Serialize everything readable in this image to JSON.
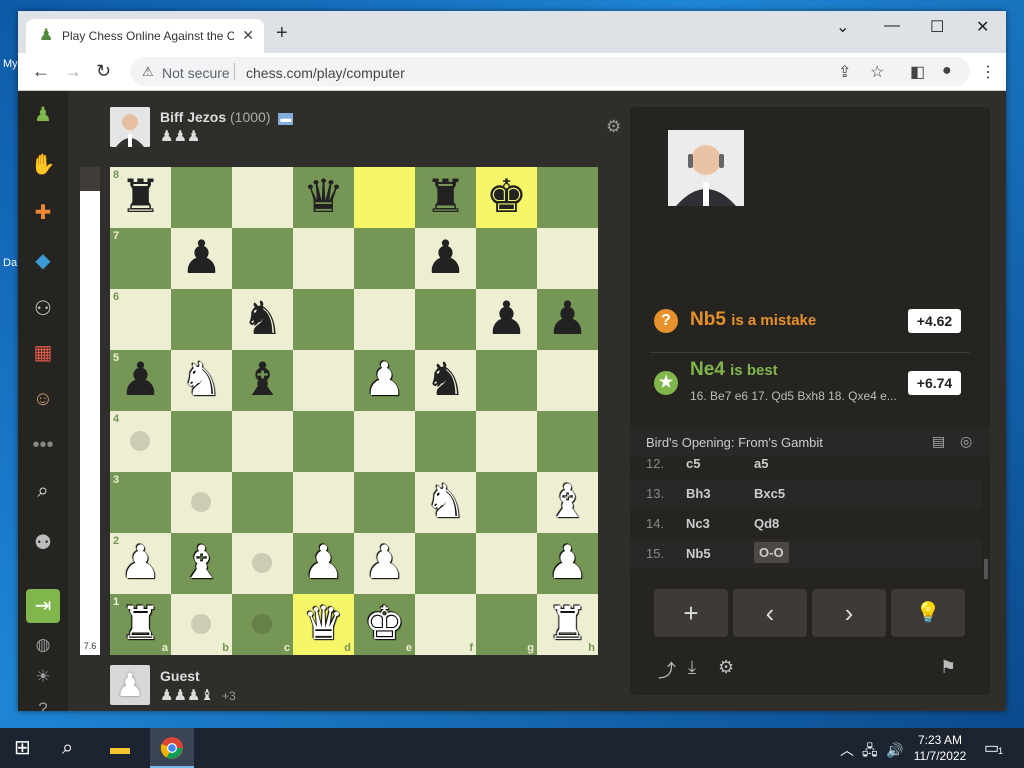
{
  "desktop": {
    "labels": [
      "My",
      "Da"
    ]
  },
  "browser": {
    "tab_title": "Play Chess Online Against the Co",
    "nav": {
      "not_secure": "Not secure",
      "url": "chess.com/play/computer"
    }
  },
  "sidebar": {
    "items": [
      "play-pawn",
      "puzzles",
      "learn",
      "lessons",
      "watch",
      "news",
      "social",
      "more",
      "search",
      "add-friend",
      "sign-up",
      "language",
      "theme",
      "help"
    ]
  },
  "top_player": {
    "name": "Biff Jezos",
    "rating": "(1000)",
    "captured": "♟♟♟"
  },
  "bottom_player": {
    "name": "Guest",
    "captured": "♟♟♟♝",
    "advantage": "+3"
  },
  "eval_bar": {
    "value": "7.6",
    "white_fraction": 0.95
  },
  "board": {
    "coords_files": [
      "a",
      "b",
      "c",
      "d",
      "e",
      "f",
      "g",
      "h"
    ],
    "coords_ranks": [
      "8",
      "7",
      "6",
      "5",
      "4",
      "3",
      "2",
      "1"
    ],
    "highlight": [
      "d1",
      "e8",
      "g8"
    ],
    "move_dots": [
      "a4",
      "b3",
      "b1",
      "c2",
      "c1"
    ],
    "pieces": [
      {
        "sq": "a8",
        "p": "♜",
        "c": "b"
      },
      {
        "sq": "d8",
        "p": "♛",
        "c": "b"
      },
      {
        "sq": "f8",
        "p": "♜",
        "c": "b"
      },
      {
        "sq": "g8",
        "p": "♚",
        "c": "b"
      },
      {
        "sq": "b7",
        "p": "♟",
        "c": "b"
      },
      {
        "sq": "f7",
        "p": "♟",
        "c": "b"
      },
      {
        "sq": "c6",
        "p": "♞",
        "c": "b"
      },
      {
        "sq": "g6",
        "p": "♟",
        "c": "b"
      },
      {
        "sq": "h6",
        "p": "♟",
        "c": "b"
      },
      {
        "sq": "a5",
        "p": "♟",
        "c": "b"
      },
      {
        "sq": "b5",
        "p": "♞",
        "c": "w"
      },
      {
        "sq": "c5",
        "p": "♝",
        "c": "b"
      },
      {
        "sq": "e5",
        "p": "♟",
        "c": "w"
      },
      {
        "sq": "f5",
        "p": "♞",
        "c": "b"
      },
      {
        "sq": "f3",
        "p": "♞",
        "c": "w"
      },
      {
        "sq": "h3",
        "p": "♝",
        "c": "w"
      },
      {
        "sq": "a2",
        "p": "♟",
        "c": "w"
      },
      {
        "sq": "b2",
        "p": "♝",
        "c": "w"
      },
      {
        "sq": "d2",
        "p": "♟",
        "c": "w"
      },
      {
        "sq": "e2",
        "p": "♟",
        "c": "w"
      },
      {
        "sq": "h2",
        "p": "♟",
        "c": "w"
      },
      {
        "sq": "a1",
        "p": "♜",
        "c": "w"
      },
      {
        "sq": "d1",
        "p": "♛",
        "c": "w"
      },
      {
        "sq": "e1",
        "p": "♚",
        "c": "w"
      },
      {
        "sq": "h1",
        "p": "♜",
        "c": "w"
      }
    ]
  },
  "analysis": {
    "mistake": {
      "move": "Nb5",
      "text": "is a mistake",
      "score": "+4.62",
      "icon": "?"
    },
    "best": {
      "move": "Ne4",
      "text": "is best",
      "score": "+6.74",
      "icon": "★",
      "line": "16. Be7 e6 17. Qd5 Bxh8 18. Qxe4 e..."
    },
    "opening": "Bird's Opening: From's Gambit",
    "moves": [
      {
        "num": "12.",
        "white": "c5",
        "black": "a5"
      },
      {
        "num": "13.",
        "white": "Bh3",
        "black": "Bxc5"
      },
      {
        "num": "14.",
        "white": "Nc3",
        "black": "Qd8"
      },
      {
        "num": "15.",
        "white": "Nb5",
        "black": "O-O"
      }
    ]
  },
  "controls": {
    "add": "+",
    "back": "‹",
    "forward": "›",
    "hint": "💡"
  },
  "taskbar": {
    "time": "7:23 AM",
    "date": "11/7/2022",
    "notif_count": "1"
  },
  "colors": {
    "light": "#eeeed2",
    "dark": "#769656",
    "highlight": "#f6f669",
    "mistake": "#e6912c",
    "best": "#81b64c"
  }
}
